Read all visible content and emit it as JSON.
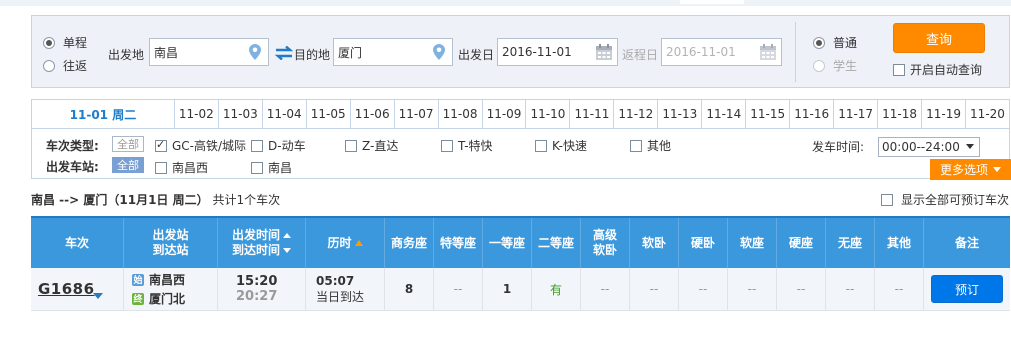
{
  "query": {
    "trip_types": [
      {
        "label": "单程",
        "selected": true
      },
      {
        "label": "往返",
        "selected": false
      }
    ],
    "from_label": "出发地",
    "from_value": "南昌",
    "to_label": "目的地",
    "to_value": "厦门",
    "depart_label": "出发日",
    "depart_value": "2016-11-01",
    "return_label": "返程日",
    "return_value": "2016-11-01",
    "passenger_types": [
      {
        "label": "普通",
        "selected": true
      },
      {
        "label": "学生",
        "selected": false
      }
    ],
    "search_button": "查询",
    "auto_query_label": "开启自动查询"
  },
  "date_tabs": {
    "active": "11-01  周二",
    "dates": [
      "11-02",
      "11-03",
      "11-04",
      "11-05",
      "11-06",
      "11-07",
      "11-08",
      "11-09",
      "11-10",
      "11-11",
      "11-12",
      "11-13",
      "11-14",
      "11-15",
      "11-16",
      "11-17",
      "11-18",
      "11-19",
      "11-20"
    ]
  },
  "filters": {
    "train_type_label": "车次类型:",
    "all_label": "全部",
    "train_types": [
      {
        "label": "GC-高铁/城际",
        "checked": true
      },
      {
        "label": "D-动车",
        "checked": false
      },
      {
        "label": "Z-直达",
        "checked": false
      },
      {
        "label": "T-特快",
        "checked": false
      },
      {
        "label": "K-快速",
        "checked": false
      },
      {
        "label": "其他",
        "checked": false
      }
    ],
    "station_label": "出发车站:",
    "stations": [
      {
        "label": "南昌西",
        "checked": false
      },
      {
        "label": "南昌",
        "checked": false
      }
    ],
    "depart_time_label": "发车时间:",
    "depart_time_value": "00:00--24:00",
    "more_options": "更多选项"
  },
  "summary": {
    "route": "南昌 --> 厦门（11月1日  周二）",
    "count": "共计1个车次",
    "show_all_label": "显示全部可预订车次"
  },
  "table": {
    "headers": {
      "train_no": "车次",
      "station_1": "出发站",
      "station_2": "到达站",
      "time_1": "出发时间",
      "time_2": "到达时间",
      "duration": "历时",
      "business": "商务座",
      "special": "特等座",
      "first": "一等座",
      "second": "二等座",
      "soft_sleeper_sr_1": "高级",
      "soft_sleeper_sr_2": "软卧",
      "soft_sleeper": "软卧",
      "hard_sleeper": "硬卧",
      "soft_seat": "软座",
      "hard_seat": "硬座",
      "no_seat": "无座",
      "other": "其他",
      "remark": "备注"
    },
    "rows": [
      {
        "train_no": "G1686",
        "from_icon": "始",
        "from_station": "南昌西",
        "to_icon": "终",
        "to_station": "厦门北",
        "depart_time": "15:20",
        "arrive_time": "20:27",
        "duration": "05:07",
        "arrival_day": "当日到达",
        "business": "8",
        "special": "--",
        "first": "1",
        "second": "有",
        "soft_sleeper_sr": "--",
        "soft_sleeper": "--",
        "hard_sleeper": "--",
        "soft_seat": "--",
        "hard_seat": "--",
        "no_seat": "--",
        "other": "--",
        "book_button": "预订"
      }
    ]
  },
  "colors": {
    "accent_orange": "#ff8a00",
    "header_blue": "#3c98dc",
    "book_blue": "#0077e8",
    "available_green": "#3c9b24"
  }
}
